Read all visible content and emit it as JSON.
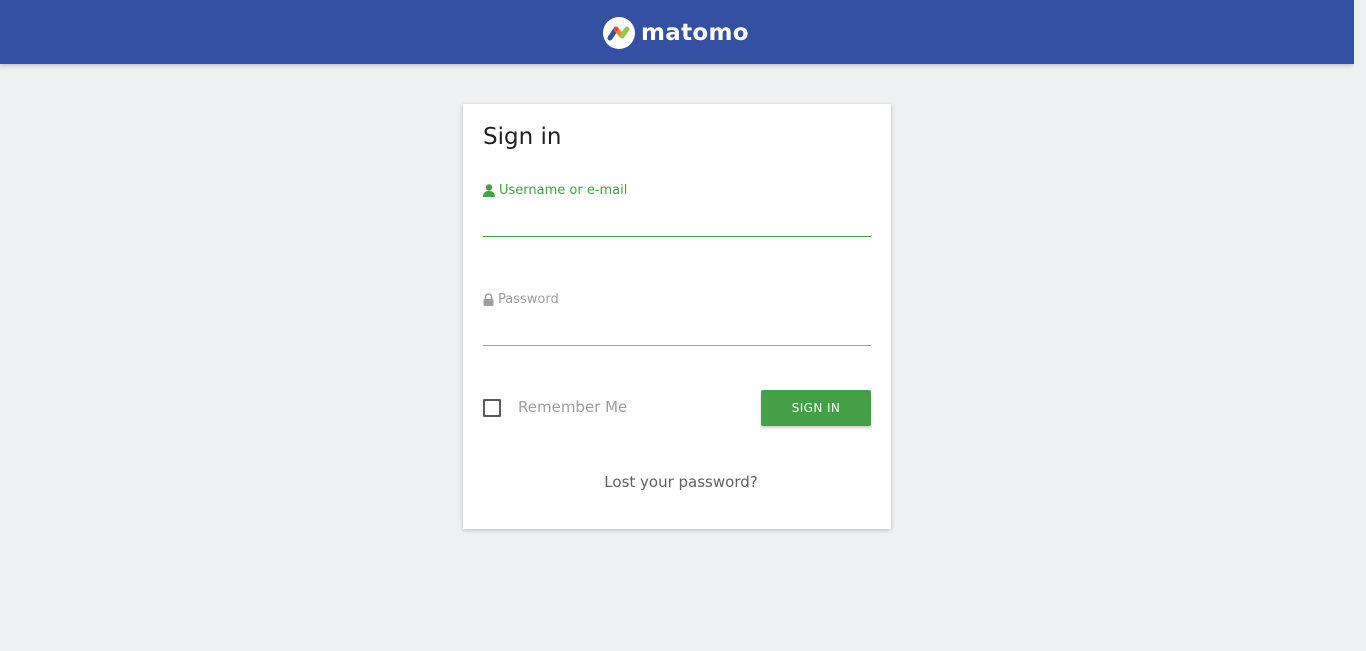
{
  "header": {
    "brand": "matomo",
    "background_color": "#3450a3",
    "logo_icon": "matomo-logo-icon"
  },
  "login_form": {
    "title": "Sign in",
    "username": {
      "label": "Username or e-mail",
      "icon": "user-icon",
      "value": "",
      "state": "focused"
    },
    "password": {
      "label": "Password",
      "icon": "lock-icon",
      "value": ""
    },
    "remember_me": {
      "label": "Remember Me",
      "checked": false
    },
    "submit_label": "SIGN IN",
    "lost_password_link": "Lost your password?"
  },
  "colors": {
    "accent_green": "#43a047",
    "page_background": "#eff0f1",
    "muted_text": "#9e9e9e"
  }
}
